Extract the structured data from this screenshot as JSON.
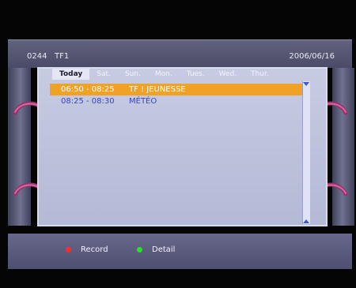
{
  "header": {
    "channel_number": "0244",
    "channel_name": "TF1",
    "date": "2006/06/16"
  },
  "tabs": [
    {
      "label": "Today",
      "active": true
    },
    {
      "label": "Sat.",
      "active": false
    },
    {
      "label": "Sun.",
      "active": false
    },
    {
      "label": "Mon.",
      "active": false
    },
    {
      "label": "Tues.",
      "active": false
    },
    {
      "label": "Wed.",
      "active": false
    },
    {
      "label": "Thur.",
      "active": false
    }
  ],
  "programs": [
    {
      "time": "06:50 - 08:25",
      "title": "TF ! JEUNESSE",
      "selected": true
    },
    {
      "time": "08:25 - 08:30",
      "title": "MÉTÉO",
      "selected": false
    }
  ],
  "footer": {
    "record_label": "Record",
    "detail_label": "Detail",
    "record_color": "#ff2a2a",
    "detail_color": "#27e327"
  },
  "icons": {
    "handle": "curved-handle-icon",
    "scroll_up": "scroll-up-arrow-icon",
    "scroll_down": "scroll-down-arrow-icon"
  }
}
